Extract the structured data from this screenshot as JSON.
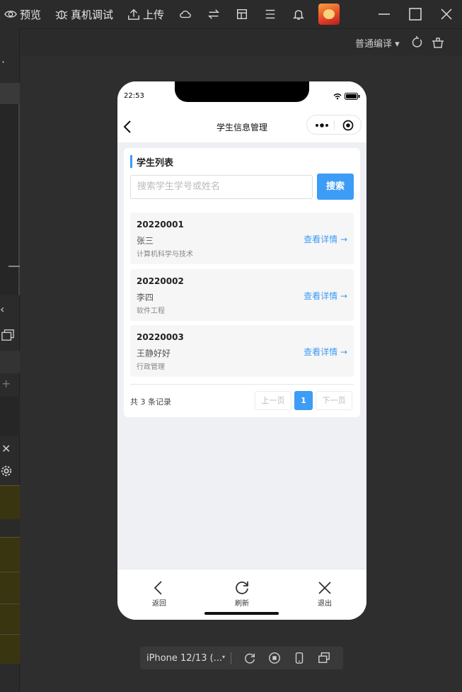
{
  "toolbar": {
    "preview": "预览",
    "debug": "真机调试",
    "upload": "上传"
  },
  "subbar": {
    "compile_mode": "普通编译 ▾"
  },
  "left_strip": {
    "dots": "·",
    "close_char": "✕",
    "plus_char": "+"
  },
  "phone": {
    "time": "22:53",
    "nav_title": "学生信息管理",
    "card_title": "学生列表",
    "search_placeholder": "搜索学生学号或姓名",
    "search_button": "搜索",
    "students": [
      {
        "id": "20220001",
        "name": "张三",
        "major": "计算机科学与技术",
        "link": "查看详情 →"
      },
      {
        "id": "20220002",
        "name": "李四",
        "major": "软件工程",
        "link": "查看详情 →"
      },
      {
        "id": "20220003",
        "name": "王静好好",
        "major": "行政管理",
        "link": "查看详情 →"
      }
    ],
    "total_text": "共 3 条记录",
    "prev_page": "上一页",
    "current_page": "1",
    "next_page": "下一页",
    "tabs": [
      {
        "label": "返回",
        "icon": "back-icon"
      },
      {
        "label": "刷新",
        "icon": "refresh-icon"
      },
      {
        "label": "退出",
        "icon": "close-icon"
      }
    ]
  },
  "device_bar": {
    "device": "iPhone 12/13 (...",
    "arrow": "▾"
  },
  "colors": {
    "accent": "#3d9cf5",
    "ide_bg": "#2e2e2e",
    "phone_bg": "#eef0f4"
  }
}
